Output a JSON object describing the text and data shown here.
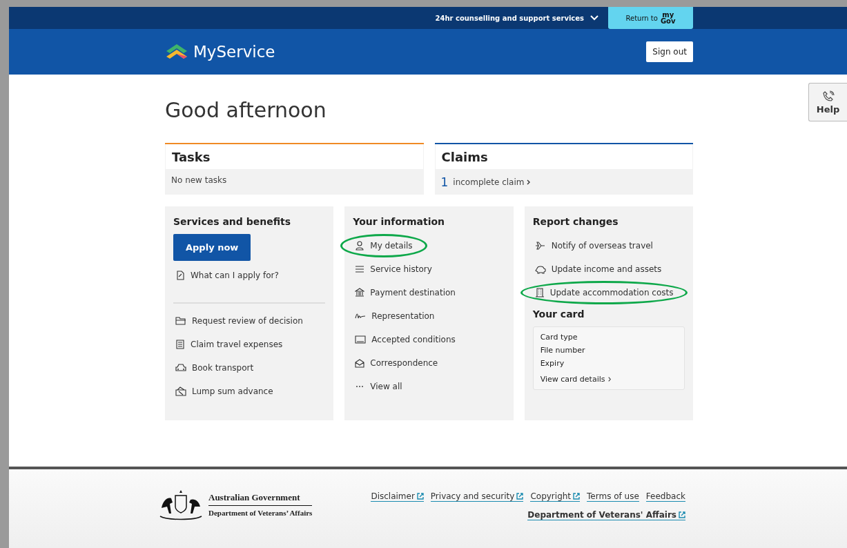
{
  "top_bar": {
    "support_link": "24hr counselling and support services",
    "return_label": "Return to",
    "mygov_top": "my",
    "mygov_bottom": "Gov"
  },
  "header": {
    "logo": "MyService",
    "sign_out": "Sign out"
  },
  "help": {
    "label": "Help"
  },
  "greeting": "Good afternoon",
  "tasks": {
    "title": "Tasks",
    "text": "No new tasks"
  },
  "claims": {
    "title": "Claims",
    "count": "1",
    "text": "incomplete claim"
  },
  "services": {
    "title": "Services and benefits",
    "apply": "Apply now",
    "primary_links": [
      {
        "label": "What can I apply for?",
        "highlighted": false
      }
    ],
    "links": [
      {
        "label": "Request review of decision",
        "highlighted": false
      },
      {
        "label": "Claim travel expenses",
        "highlighted": false
      },
      {
        "label": "Book transport",
        "highlighted": false
      },
      {
        "label": "Lump sum advance",
        "highlighted": false
      }
    ]
  },
  "your_information": {
    "title": "Your information",
    "links": [
      {
        "label": "My details",
        "highlighted": true
      },
      {
        "label": "Service history",
        "highlighted": false
      },
      {
        "label": "Payment destination",
        "highlighted": false
      },
      {
        "label": "Representation",
        "highlighted": false
      },
      {
        "label": "Accepted conditions",
        "highlighted": false
      },
      {
        "label": "Correspondence",
        "highlighted": false
      },
      {
        "label": "View all",
        "highlighted": false
      }
    ]
  },
  "report_changes": {
    "title": "Report changes",
    "links": [
      {
        "label": "Notify of overseas travel",
        "highlighted": false
      },
      {
        "label": "Update income and assets",
        "highlighted": false
      },
      {
        "label": "Update accommodation costs",
        "highlighted": true
      }
    ]
  },
  "your_card": {
    "title": "Your card",
    "fields": [
      "Card type",
      "File number",
      "Expiry"
    ],
    "link": "View card details"
  },
  "footer": {
    "gov_line1": "Australian Government",
    "gov_line2": "Department of Veterans’ Affairs",
    "links": [
      {
        "label": "Disclaimer",
        "external": true
      },
      {
        "label": "Privacy and security",
        "external": true
      },
      {
        "label": "Copyright",
        "external": true
      },
      {
        "label": "Terms of use",
        "external": false
      },
      {
        "label": "Feedback",
        "external": false
      }
    ],
    "dept_link": {
      "label": "Department of Veterans' Affairs",
      "external": true
    }
  }
}
